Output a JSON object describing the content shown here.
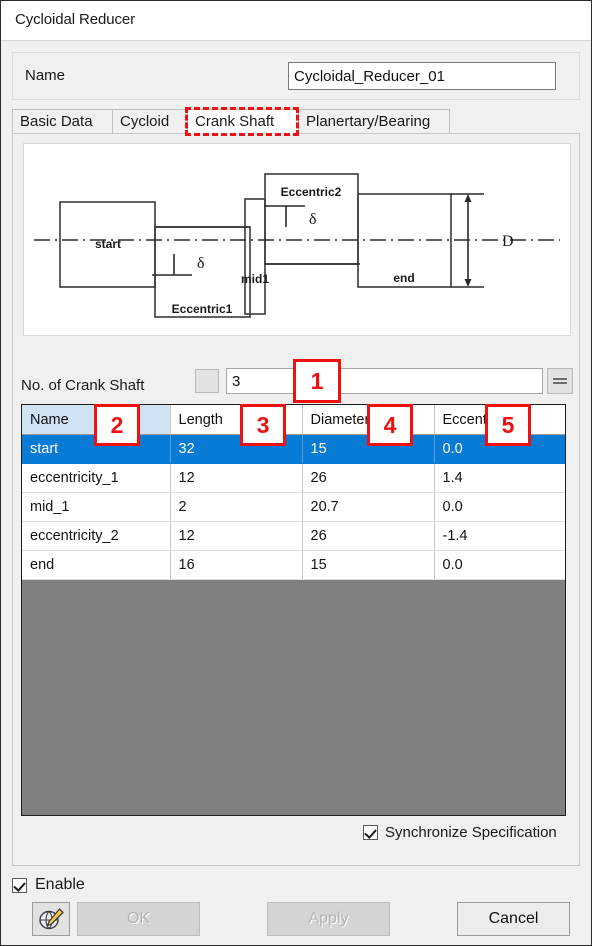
{
  "window": {
    "title": "Cycloidal Reducer"
  },
  "name_group": {
    "label": "Name",
    "value": "Cycloidal_Reducer_01",
    "placeholder": ""
  },
  "tabs": [
    {
      "label": "Basic Data",
      "active": false
    },
    {
      "label": "Cycloid",
      "active": false
    },
    {
      "label": "Crank Shaft",
      "active": true
    },
    {
      "label": "Planertary/Bearing",
      "active": false
    }
  ],
  "diagram": {
    "labels": {
      "start": "start",
      "eccentric1": "Eccentric1",
      "mid1": "mid1",
      "eccentric2": "Eccentric2",
      "end": "end",
      "delta1": "δ",
      "delta2": "δ",
      "diameter": "D"
    }
  },
  "crank_shaft_count": {
    "label": "No. of Crank Shaft",
    "value": "3",
    "equals_button_label": "=",
    "small_button_label": ""
  },
  "table": {
    "columns": [
      "Name",
      "Length",
      "Diameter",
      "Eccentricity"
    ],
    "selected_column": "Name",
    "rows": [
      {
        "name": "start",
        "length": "32",
        "diameter": "15",
        "eccentricity": "0.0",
        "selected": true
      },
      {
        "name": "eccentricity_1",
        "length": "12",
        "diameter": "26",
        "eccentricity": "1.4",
        "selected": false
      },
      {
        "name": "mid_1",
        "length": "2",
        "diameter": "20.7",
        "eccentricity": "0.0",
        "selected": false
      },
      {
        "name": "eccentricity_2",
        "length": "12",
        "diameter": "26",
        "eccentricity": "-1.4",
        "selected": false
      },
      {
        "name": "end",
        "length": "16",
        "diameter": "15",
        "eccentricity": "0.0",
        "selected": false
      }
    ]
  },
  "sync_checkbox": {
    "label": "Synchronize Specification",
    "checked": true
  },
  "enable_checkbox": {
    "label": "Enable",
    "checked": true
  },
  "buttons": {
    "ok": "OK",
    "apply": "Apply",
    "cancel": "Cancel",
    "icon": "globe-pencil-icon"
  },
  "annotations": [
    {
      "number": "1"
    },
    {
      "number": "2"
    },
    {
      "number": "3"
    },
    {
      "number": "4"
    },
    {
      "number": "5"
    }
  ],
  "colors": {
    "selection_blue": "#0a7bd4",
    "selected_header_blue": "#cfe3f5",
    "annotation_red": "#ee1111",
    "table_backdrop_grey": "#808080"
  }
}
